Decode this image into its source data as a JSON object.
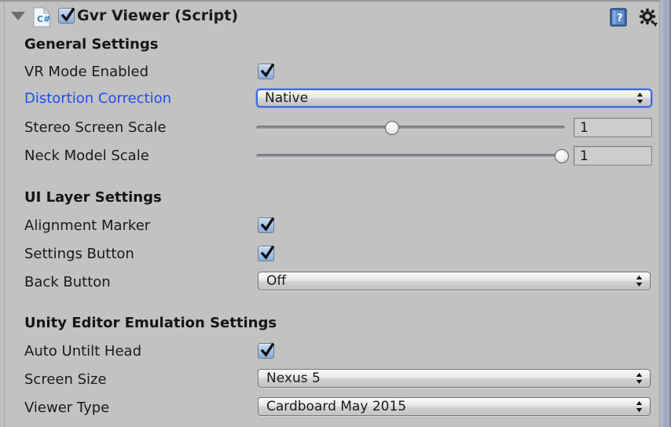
{
  "component": {
    "title": "Gvr Viewer (Script)",
    "enabled_checkbox": true,
    "expanded": true,
    "script_icon": "csharp-script-icon",
    "help_icon": "help-book-icon",
    "menu_icon": "gear-dropdown-icon"
  },
  "sections": [
    {
      "title": "General Settings",
      "rows": [
        {
          "label": "VR Mode Enabled",
          "type": "checkbox",
          "value": true,
          "modified": false
        },
        {
          "label": "Distortion Correction",
          "type": "popup",
          "value": "Native",
          "modified": true,
          "focused": true
        },
        {
          "label": "Stereo Screen Scale",
          "type": "slider",
          "value": "1",
          "fill_percent": 44,
          "modified": false
        },
        {
          "label": "Neck Model Scale",
          "type": "slider",
          "value": "1",
          "fill_percent": 99,
          "modified": false
        }
      ]
    },
    {
      "title": "UI Layer Settings",
      "rows": [
        {
          "label": "Alignment Marker",
          "type": "checkbox",
          "value": true,
          "modified": false
        },
        {
          "label": "Settings Button",
          "type": "checkbox",
          "value": true,
          "modified": false
        },
        {
          "label": "Back Button",
          "type": "popup",
          "value": "Off",
          "modified": false,
          "focused": false
        }
      ]
    },
    {
      "title": "Unity Editor Emulation Settings",
      "rows": [
        {
          "label": "Auto Untilt Head",
          "type": "checkbox",
          "value": true,
          "modified": false
        },
        {
          "label": "Screen Size",
          "type": "popup",
          "value": "Nexus 5",
          "modified": false,
          "focused": false
        },
        {
          "label": "Viewer Type",
          "type": "popup",
          "value": "Cardboard May 2015",
          "modified": false,
          "focused": false
        }
      ]
    }
  ],
  "colors": {
    "background": "#c2c2c2",
    "modified_label": "#1c4ff0",
    "checkbox_fill": "#86aede",
    "focus_border": "#3b6ae1"
  }
}
